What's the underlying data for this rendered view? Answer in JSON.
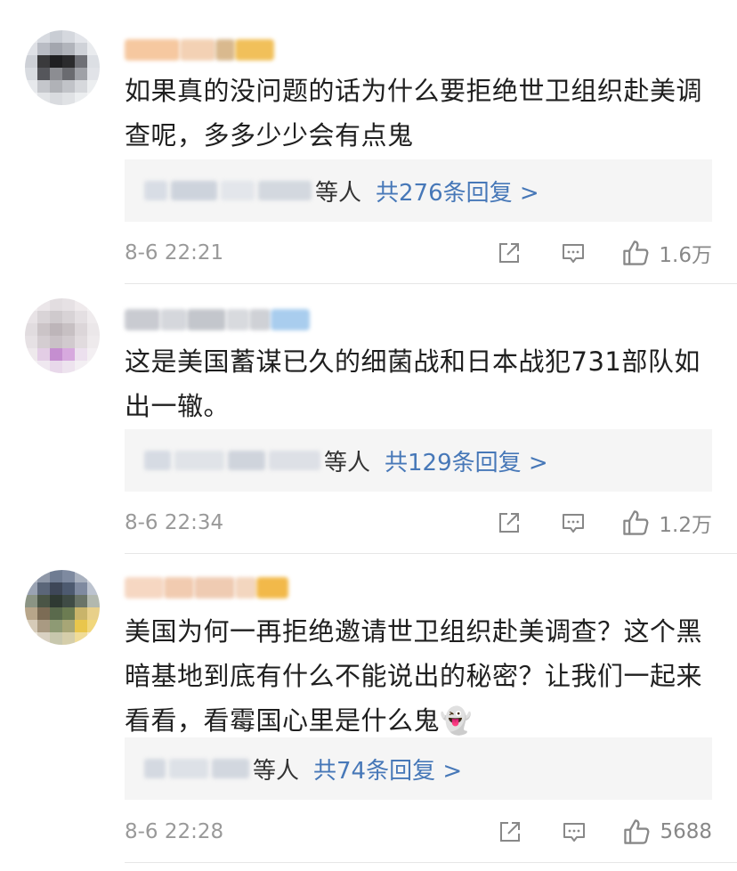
{
  "comments": [
    {
      "text": "如果真的没问题的话为什么要拒绝世卫组织赴美调查呢，多多少少会有点鬼",
      "reply_suffix": "等人",
      "reply_total": "共276条回复 >",
      "time": "8-6 22:21",
      "likes": "1.6万",
      "icons": [
        "share-icon",
        "comment-icon",
        "thumbs-up-icon"
      ]
    },
    {
      "text": "这是美国蓄谋已久的细菌战和日本战犯731部队如出一辙。",
      "reply_suffix": "等人",
      "reply_total": "共129条回复 >",
      "time": "8-6 22:34",
      "likes": "1.2万",
      "icons": [
        "share-icon",
        "comment-icon",
        "thumbs-up-icon"
      ]
    },
    {
      "text": "美国为何一再拒绝邀请世卫组织赴美调查？这个黑暗基地到底有什么不能说出的秘密？让我们一起来看看，看霉国心里是什么鬼👻",
      "reply_suffix": "等人",
      "reply_total": "共74条回复 >",
      "time": "8-6 22:28",
      "likes": "5688",
      "icons": [
        "share-icon",
        "comment-icon",
        "thumbs-up-icon"
      ]
    }
  ],
  "colors": {
    "link": "#4778b8",
    "meta": "#999999",
    "reply_bg": "#f5f5f5"
  }
}
